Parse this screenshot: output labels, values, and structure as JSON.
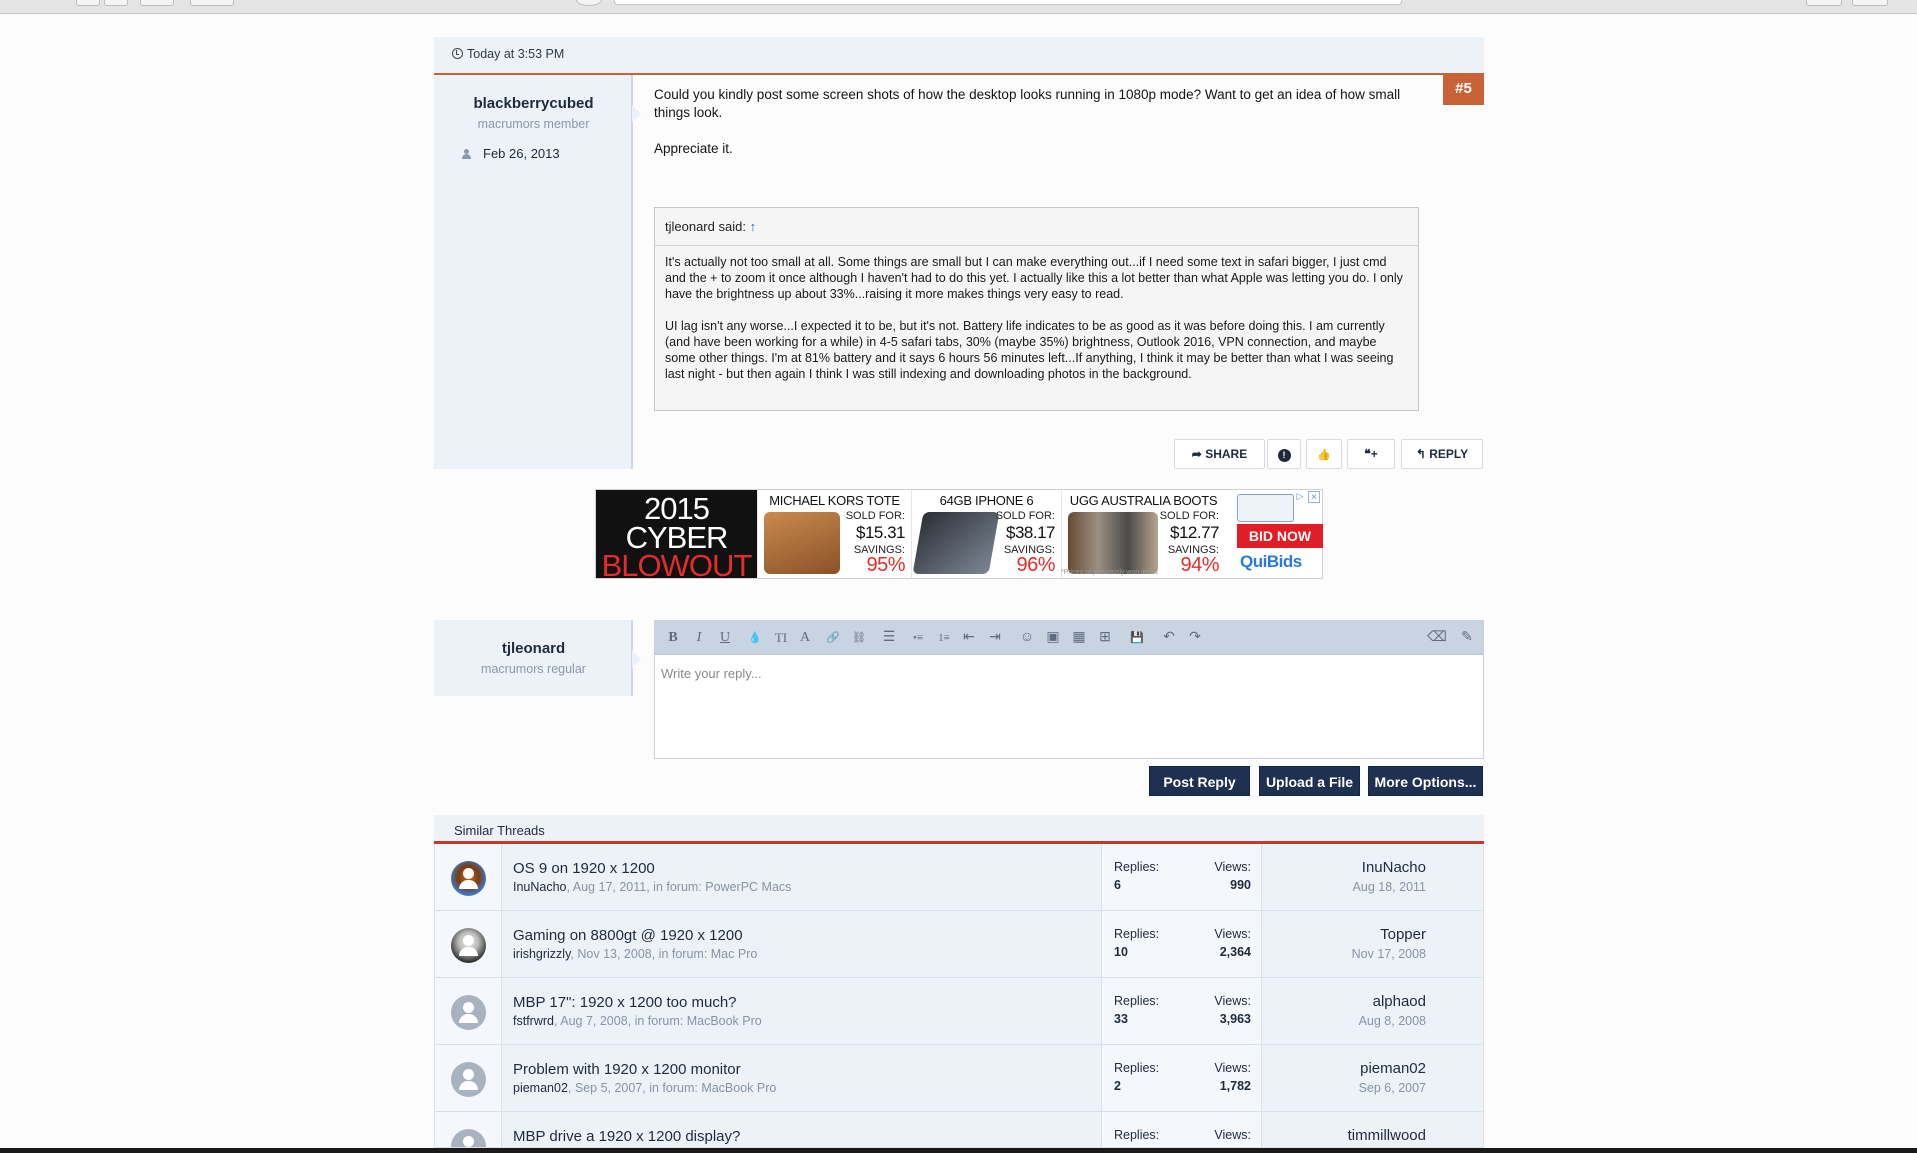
{
  "post": {
    "date": "Today at 3:53 PM",
    "number": "#5",
    "user": {
      "name": "blackberrycubed",
      "title": "macrumors member",
      "joined": "Feb 26, 2013"
    },
    "message": [
      "Could you kindly post some screen shots of how the desktop looks running in 1080p mode? Want to get an idea of how small things look.",
      "Appreciate it."
    ],
    "quote": {
      "author": "tjleonard said:",
      "arrow": "↑",
      "paragraphs": [
        "It's actually not too small at all. Some things are small but I can make everything out...if I need some text in safari bigger, I just cmd and the + to zoom it once although I haven't had to do this yet. I actually like this a lot better than what Apple was letting you do. I only have the brightness up about 33%...raising it more makes things very easy to read.",
        "UI lag isn't any worse...I expected it to be, but it's not. Battery life indicates to be as good as it was before doing this. I am currently (and have been working for a while) in 4-5 safari tabs, 30% (maybe 35%) brightness, Outlook 2016, VPN connection, and maybe some other things. I'm at 81% battery and it says 6 hours 56 minutes left...If anything, I think it may be better than what I was seeing last night - but then again I think I was still indexing and downloading photos in the background."
      ]
    },
    "actions": {
      "share": "SHARE",
      "report": "!",
      "like": "👍",
      "quote_plus": "❝+",
      "reply": "REPLY"
    }
  },
  "ad": {
    "left": {
      "year": "2015",
      "line2": "CYBER",
      "line3": "BLOWOUT"
    },
    "items": [
      {
        "title": "MICHAEL KORS TOTE",
        "sold_label": "SOLD FOR:",
        "price": "$15.31",
        "savings_label": "SAVINGS:",
        "savings": "95%"
      },
      {
        "title": "64GB IPHONE 6",
        "sold_label": "SOLD FOR:",
        "price": "$38.17",
        "savings_label": "SAVINGS:",
        "savings": "96%"
      },
      {
        "title": "UGG AUSTRALIA BOOTS",
        "sold_label": "SOLD FOR:",
        "price": "$12.77",
        "savings_label": "SAVINGS:",
        "savings": "94%"
      }
    ],
    "bid_now": "BID NOW",
    "brand": "QuiBids",
    "footnote": "*Prices of previously won items"
  },
  "reply": {
    "user": {
      "name": "tjleonard",
      "title": "macrumors regular"
    },
    "placeholder": "Write your reply...",
    "toolbar": [
      "B",
      "I",
      "U",
      "💧",
      "TI",
      "A",
      "🔗",
      "⛓",
      "☰",
      "•≡",
      "1≡",
      "⇤",
      "⇥",
      "☺",
      "▣",
      "▦",
      "⊞",
      "💾",
      "↶",
      "↷"
    ],
    "buttons": {
      "post": "Post Reply",
      "upload": "Upload a File",
      "more": "More Options..."
    }
  },
  "similar": {
    "heading": "Similar Threads",
    "replies_label": "Replies:",
    "views_label": "Views:",
    "threads": [
      {
        "title": "OS 9 on 1920 x 1200",
        "author": "InuNacho",
        "info": ", Aug 17, 2011, in forum: PowerPC Macs",
        "replies": "6",
        "views": "990",
        "last_poster": "InuNacho",
        "last_date": "Aug 18, 2011"
      },
      {
        "title": "Gaming on 8800gt @ 1920 x 1200",
        "author": "irishgrizzly",
        "info": ", Nov 13, 2008, in forum: Mac Pro",
        "replies": "10",
        "views": "2,364",
        "last_poster": "Topper",
        "last_date": "Nov 17, 2008"
      },
      {
        "title": "MBP 17\": 1920 x 1200 too much?",
        "author": "fstfrwrd",
        "info": ", Aug 7, 2008, in forum: MacBook Pro",
        "replies": "33",
        "views": "3,963",
        "last_poster": "alphaod",
        "last_date": "Aug 8, 2008"
      },
      {
        "title": "Problem with 1920 x 1200 monitor",
        "author": "pieman02",
        "info": ", Sep 5, 2007, in forum: MacBook Pro",
        "replies": "2",
        "views": "1,782",
        "last_poster": "pieman02",
        "last_date": "Sep 6, 2007"
      },
      {
        "title": "MBP drive a 1920 x 1200 display?",
        "author": "",
        "info": "",
        "replies": "",
        "views": "",
        "last_poster": "timmillwood",
        "last_date": ""
      }
    ]
  }
}
